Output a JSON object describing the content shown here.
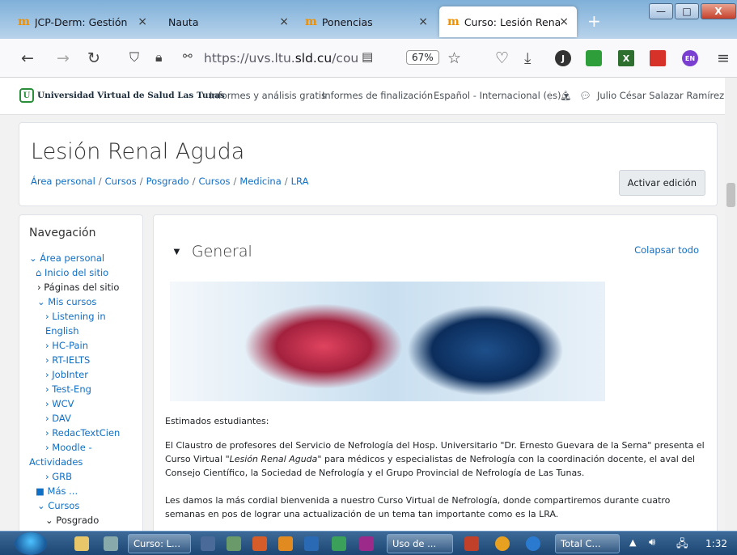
{
  "browser": {
    "tabs": [
      {
        "label": "JCP-Derm: Gestión",
        "close": "×"
      },
      {
        "label": "Nauta",
        "close": "×"
      },
      {
        "label": "Ponencias",
        "close": "×"
      },
      {
        "label": "Curso: Lesión Renal",
        "close": "×"
      }
    ],
    "tab_favicon": "m",
    "new_tab": "+",
    "window_buttons": {
      "minimize": "—",
      "maximize": "□",
      "close": "X"
    },
    "url_prefix": "https://uvs.ltu.",
    "url_domain": "sld.cu",
    "url_suffix": "/course/vie",
    "zoom": "67%",
    "extensions": [
      {
        "icon": "j-extension-icon",
        "label": "J",
        "color": "#333333"
      },
      {
        "icon": "green-extension-icon",
        "label": "",
        "color": "#2e9e3a"
      },
      {
        "icon": "x-extension-icon",
        "label": "X",
        "color": "#2e6e2e"
      },
      {
        "icon": "red-extension-icon",
        "label": "",
        "color": "#d6322a"
      },
      {
        "icon": "en-extension-icon",
        "label": "EN",
        "color": "#7a3fd0"
      }
    ]
  },
  "moodle_header": {
    "brand": "Universidad Virtual de Salud Las Tunas",
    "link1": "Informes y análisis gratis",
    "link2": "Informes de finalización",
    "language": "Español - Internacional (es)",
    "user": "Julio César Salazar Ramírez"
  },
  "page_header": {
    "title": "Lesión Renal Aguda",
    "breadcrumb": [
      "Área personal",
      "Cursos",
      "Posgrado",
      "Cursos",
      "Medicina",
      "LRA"
    ],
    "edit_button": "Activar edición"
  },
  "nav_block": {
    "heading": "Navegación",
    "items": [
      "Área personal",
      "Inicio del sitio",
      "Páginas del sitio",
      "Mis cursos",
      "Listening in",
      "English",
      "HC-Pain",
      "RT-IELTS",
      "JobInter",
      "Test-Eng",
      "WCV",
      "DAV",
      "RedacTextCien",
      "Moodle -",
      "Actividades",
      "GRB",
      "Más ...",
      "Cursos",
      "Posgrado"
    ]
  },
  "section": {
    "title": "General",
    "collapse_all": "Colapsar todo",
    "greeting": "Estimados estudiantes:",
    "paragraph1_start": "El Claustro de profesores del Servicio de Nefrología del Hosp. Universitario \"Dr. Ernesto Guevara de la Serna\" presenta el Curso Virtual \"",
    "paragraph1_italic": "Lesión Renal Aguda",
    "paragraph1_end": "\" para médicos y especialistas de Nefrología con la coordinación docente, el aval del Consejo Científico, la Sociedad de Nefrología y el Grupo Provincial de Nefrología de Las Tunas.",
    "paragraph2": "Les damos la más cordial bienvenida a nuestro Curso Virtual de Nefrología, donde compartiremos durante cuatro semanas en pos de lograr una actualización de un tema tan importante como es la LRA."
  },
  "taskbar": {
    "buttons": [
      "Curso: L...",
      "Uso de ...",
      "Total C..."
    ],
    "clock": "1:32"
  }
}
